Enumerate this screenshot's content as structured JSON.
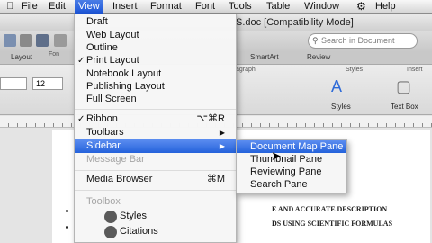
{
  "menubar": {
    "apple": "",
    "items": [
      "File",
      "Edit",
      "View",
      "Insert",
      "Format",
      "Font",
      "Tools",
      "Table",
      "Window",
      "Help"
    ],
    "script_icon": "⚙"
  },
  "window": {
    "title": "S.doc [Compatibility Mode]",
    "search_placeholder": "Search in Document",
    "ribbon_tabs": [
      "Layout",
      "SmartArt",
      "Review"
    ],
    "ribbon_groups": [
      "Fon",
      "agraph",
      "Styles",
      "Insert"
    ],
    "font_size": "12",
    "styles_label": "Styles",
    "textbox_label": "Text Box"
  },
  "document": {
    "line1": "E AND ACCURATE DESCRIPTION",
    "line2": "DS USING SCIENTIFIC FORMULAS"
  },
  "view_menu": {
    "draft": "Draft",
    "web_layout": "Web Layout",
    "outline": "Outline",
    "print_layout": "Print Layout",
    "notebook_layout": "Notebook Layout",
    "publishing_layout": "Publishing Layout",
    "full_screen": "Full Screen",
    "ribbon": "Ribbon",
    "ribbon_shortcut": "⌥⌘R",
    "toolbars": "Toolbars",
    "sidebar": "Sidebar",
    "message_bar": "Message Bar",
    "media_browser": "Media Browser",
    "media_browser_shortcut": "⌘M",
    "toolbox": "Toolbox",
    "styles": "Styles",
    "citations": "Citations",
    "check": "✓",
    "arrow": "▶"
  },
  "sidebar_submenu": {
    "document_map_pane": "Document Map Pane",
    "thumbnail_pane": "Thumbnail Pane",
    "reviewing_pane": "Reviewing Pane",
    "search_pane": "Search Pane"
  },
  "colors": {
    "highlight": "#2a66dd",
    "menu_bg": "#f6f6f6",
    "disabled_text": "#a5a5a5"
  }
}
